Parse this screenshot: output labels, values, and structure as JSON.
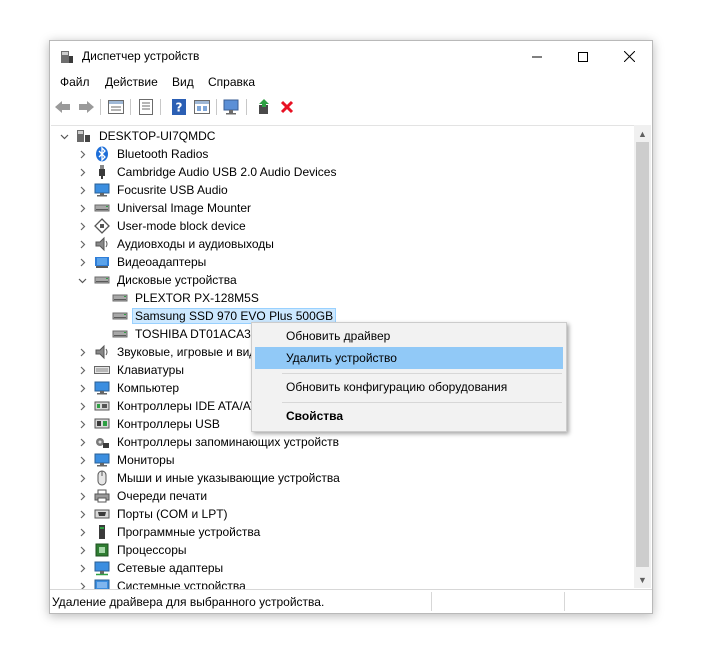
{
  "window": {
    "title": "Диспетчер устройств",
    "minimize_glyph": "—",
    "maximize_glyph": "☐",
    "close_glyph": "✕"
  },
  "menu": [
    "Файл",
    "Действие",
    "Вид",
    "Справка"
  ],
  "toolbar": [
    {
      "name": "back-icon"
    },
    {
      "name": "forward-icon"
    },
    {
      "name": "properties-icon"
    },
    {
      "name": "device-list-icon"
    },
    {
      "name": "help-icon"
    },
    {
      "name": "view-icon"
    },
    {
      "name": "scan-hardware-icon"
    },
    {
      "name": "update-driver-icon"
    },
    {
      "name": "uninstall-icon"
    }
  ],
  "tree": {
    "root": "DESKTOP-UI7QMDC",
    "items": [
      {
        "label": "Bluetooth Radios",
        "icon": "bluetooth-icon",
        "expanded": false
      },
      {
        "label": "Cambridge Audio USB 2.0 Audio Devices",
        "icon": "usb-plug-icon",
        "expanded": false
      },
      {
        "label": "Focusrite USB Audio",
        "icon": "monitor-icon",
        "expanded": false
      },
      {
        "label": "Universal Image Mounter",
        "icon": "disk-drive-icon",
        "expanded": false
      },
      {
        "label": "User-mode block device",
        "icon": "block-device-icon",
        "expanded": false
      },
      {
        "label": "Аудиовходы и аудиовыходы",
        "icon": "speaker-icon",
        "expanded": false
      },
      {
        "label": "Видеоадаптеры",
        "icon": "display-adapter-icon",
        "expanded": false
      },
      {
        "label": "Дисковые устройства",
        "icon": "disk-drive-icon",
        "expanded": true,
        "children": [
          {
            "label": "PLEXTOR PX-128M5S",
            "icon": "disk-drive-icon"
          },
          {
            "label": "Samsung SSD 970 EVO Plus 500GB",
            "icon": "disk-drive-icon",
            "selected": true
          },
          {
            "label": "TOSHIBA DT01ACA300",
            "icon": "disk-drive-icon"
          }
        ]
      },
      {
        "label": "Звуковые, игровые и вид",
        "icon": "speaker-icon",
        "expanded": false
      },
      {
        "label": "Клавиатуры",
        "icon": "keyboard-icon",
        "expanded": false
      },
      {
        "label": "Компьютер",
        "icon": "monitor-icon",
        "expanded": false
      },
      {
        "label": "Контроллеры IDE ATA/AT",
        "icon": "ide-controller-icon",
        "expanded": false
      },
      {
        "label": "Контроллеры USB",
        "icon": "usb-controller-icon",
        "expanded": false
      },
      {
        "label": "Контроллеры запоминающих устройств",
        "icon": "storage-controller-icon",
        "expanded": false
      },
      {
        "label": "Мониторы",
        "icon": "monitor-icon",
        "expanded": false
      },
      {
        "label": "Мыши и иные указывающие устройства",
        "icon": "mouse-icon",
        "expanded": false
      },
      {
        "label": "Очереди печати",
        "icon": "printer-icon",
        "expanded": false
      },
      {
        "label": "Порты (COM и LPT)",
        "icon": "port-icon",
        "expanded": false
      },
      {
        "label": "Программные устройства",
        "icon": "software-device-icon",
        "expanded": false
      },
      {
        "label": "Процессоры",
        "icon": "processor-icon",
        "expanded": false
      },
      {
        "label": "Сетевые адаптеры",
        "icon": "network-adapter-icon",
        "expanded": false
      },
      {
        "label": "Системные устройства",
        "icon": "system-device-icon",
        "expanded": false
      }
    ]
  },
  "context_menu": {
    "items": [
      {
        "label": "Обновить драйвер",
        "highlighted": false,
        "bold": false
      },
      {
        "label": "Удалить устройство",
        "highlighted": true,
        "bold": false
      },
      {
        "label": "Обновить конфигурацию оборудования",
        "highlighted": false,
        "bold": false
      },
      {
        "label": "Свойства",
        "highlighted": false,
        "bold": true
      }
    ]
  },
  "status": {
    "text": "Удаление драйвера для выбранного устройства."
  },
  "colors": {
    "selection": "#cce8ff",
    "menu_highlight": "#91c9f7",
    "uninstall_red": "#e81123"
  }
}
